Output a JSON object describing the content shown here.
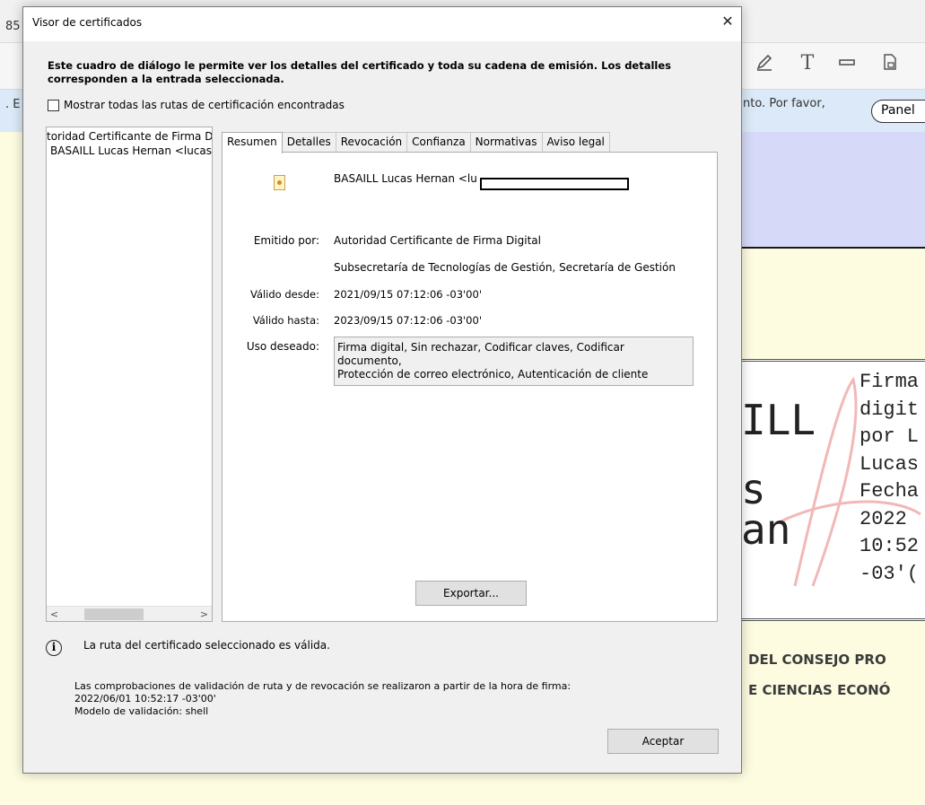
{
  "background": {
    "page_number": "85",
    "message_lead": ". E",
    "message_tail": "nto. Por favor,",
    "panel_button": "Panel",
    "signature_large": [
      "ILL",
      "s",
      "an"
    ],
    "signature_small": [
      "Firma",
      "digit",
      "por L",
      "Lucas",
      "Fecha",
      "2022",
      "10:52",
      "-03'("
    ],
    "org_lines": [
      "DEL CONSEJO PRO",
      "E CIENCIAS ECONÓ"
    ]
  },
  "dialog": {
    "title": "Visor de certificados",
    "close": "✕",
    "intro": "Este cuadro de diálogo le permite ver los detalles del certificado y toda su cadena de emisión. Los detalles corresponden a la entrada seleccionada.",
    "show_all_paths": "Mostrar todas las rutas de certificación encontradas",
    "tree": [
      "toridad Certificante de Firma D",
      "BASAILL Lucas Hernan <lucas"
    ],
    "tabs": [
      "Resumen",
      "Detalles",
      "Revocación",
      "Confianza",
      "Normativas",
      "Aviso legal"
    ],
    "summary": {
      "subject": "BASAILL Lucas Hernan <lu",
      "issued_by_label": "Emitido por:",
      "issuer_cn": "Autoridad Certificante de Firma Digital",
      "issuer_org": "Subsecretaría de Tecnologías de Gestión, Secretaría de Gestión",
      "valid_from_label": "Válido desde:",
      "valid_from": "2021/09/15 07:12:06 -03'00'",
      "valid_to_label": "Válido hasta:",
      "valid_to": "2023/09/15 07:12:06 -03'00'",
      "usage_label": "Uso deseado:",
      "usage_line1": "Firma digital, Sin rechazar, Codificar claves, Codificar documento,",
      "usage_line2": "Protección de correo electrónico, Autenticación de cliente",
      "export_button": "Exportar..."
    },
    "status": {
      "valid": "La ruta del certificado seleccionado es válida.",
      "check_line1": "Las comprobaciones de validación de ruta y de revocación se realizaron a partir de la hora de firma:",
      "check_line2": "2022/06/01 10:52:17 -03'00'",
      "model": "Modelo de validación: shell"
    },
    "ok_button": "Aceptar"
  }
}
